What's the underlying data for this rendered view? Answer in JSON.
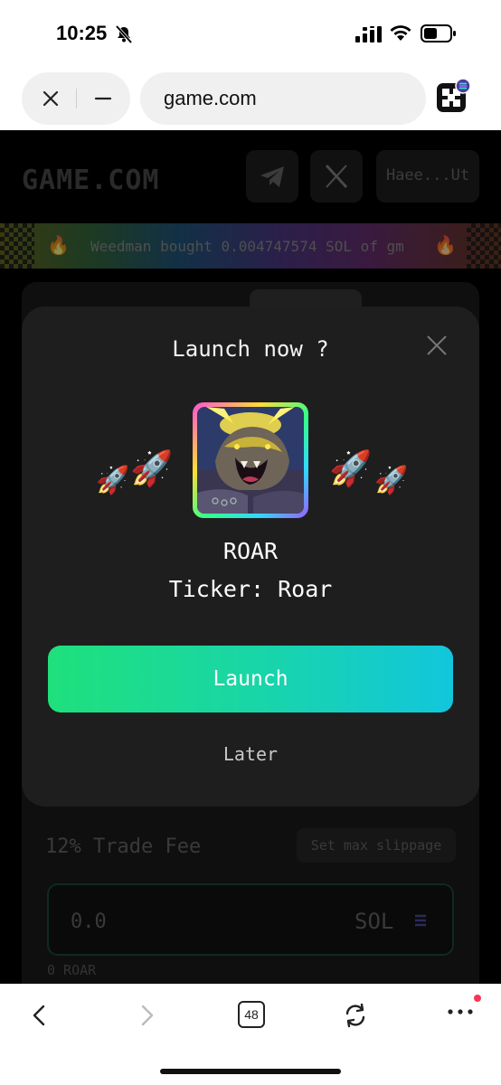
{
  "status_bar": {
    "time": "10:25"
  },
  "browser": {
    "url": "game.com"
  },
  "site": {
    "logo_text": "GAME.COM",
    "wallet_label": "Haee...Ut",
    "ticker_text": "Weedman bought 0.004747574 SOL of gm",
    "ticker_emoji": "🔥",
    "fee_label": "12% Trade Fee",
    "slippage_label": "Set max slippage",
    "amount_value": "0.0",
    "amount_currency": "SOL",
    "below_label": "0 ROAR"
  },
  "modal": {
    "title": "Launch now ?",
    "token_name": "ROAR",
    "ticker_line": "Ticker: Roar",
    "rocket_emoji": "🚀",
    "launch_label": "Launch",
    "later_label": "Later"
  },
  "toolbar": {
    "tab_count": "48"
  },
  "colors": {
    "launch_gradient_start": "#1fe07c",
    "launch_gradient_end": "#12c6dc",
    "modal_bg": "#1e1e1e",
    "notification_dot": "#ff3355"
  }
}
